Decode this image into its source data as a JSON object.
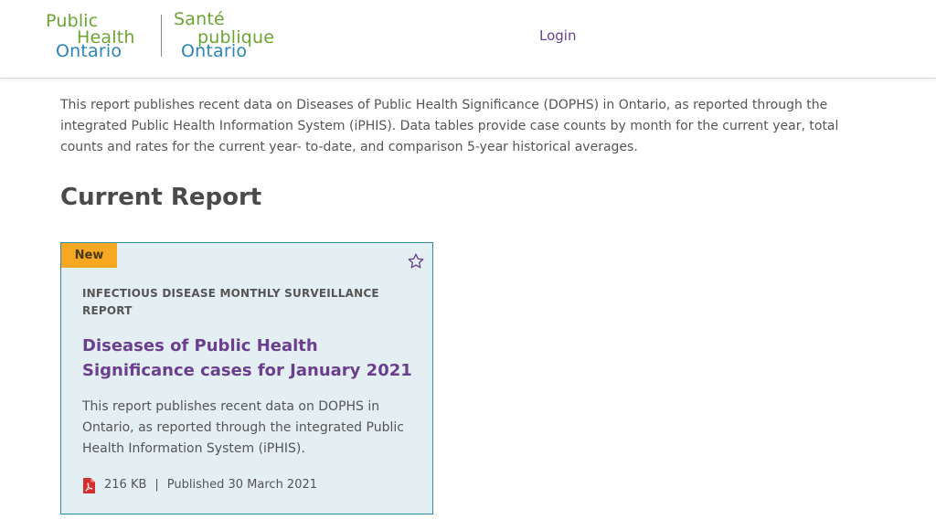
{
  "header": {
    "logo": {
      "en_line1": "Public",
      "en_line2": "Health",
      "en_line3": "Ontario",
      "fr_line1": "Santé",
      "fr_line2": "publique",
      "fr_line3": "Ontario"
    },
    "login_label": "Login"
  },
  "intro_text": "This report publishes recent data on Diseases of Public Health Significance (DOPHS) in Ontario, as reported through the integrated Public Health Information System (iPHIS).  Data tables provide case counts by month for the current year, total counts and rates for the current year- to-date, and comparison 5-year historical averages.",
  "section_title": "Current Report",
  "card": {
    "badge": "New",
    "bookmark_icon": "star-outline-icon",
    "category": "INFECTIOUS DISEASE MONTHLY SURVEILLANCE REPORT",
    "title": "Diseases of Public Health Significance cases for January 2021",
    "description": "This report publishes recent data on DOPHS in Ontario, as reported through the integrated Public Health Information System (iPHIS).",
    "file_icon": "pdf-icon",
    "file_size": "216 KB",
    "separator": "|",
    "published": "Published 30 March 2021"
  },
  "colors": {
    "brand_green": "#6aa533",
    "brand_blue": "#2a85b8",
    "link_purple": "#6b3f8e",
    "badge_orange": "#f7a823",
    "card_bg": "#e3eff3",
    "card_border": "#2f8aa8",
    "pdf_red": "#d32f2f"
  }
}
